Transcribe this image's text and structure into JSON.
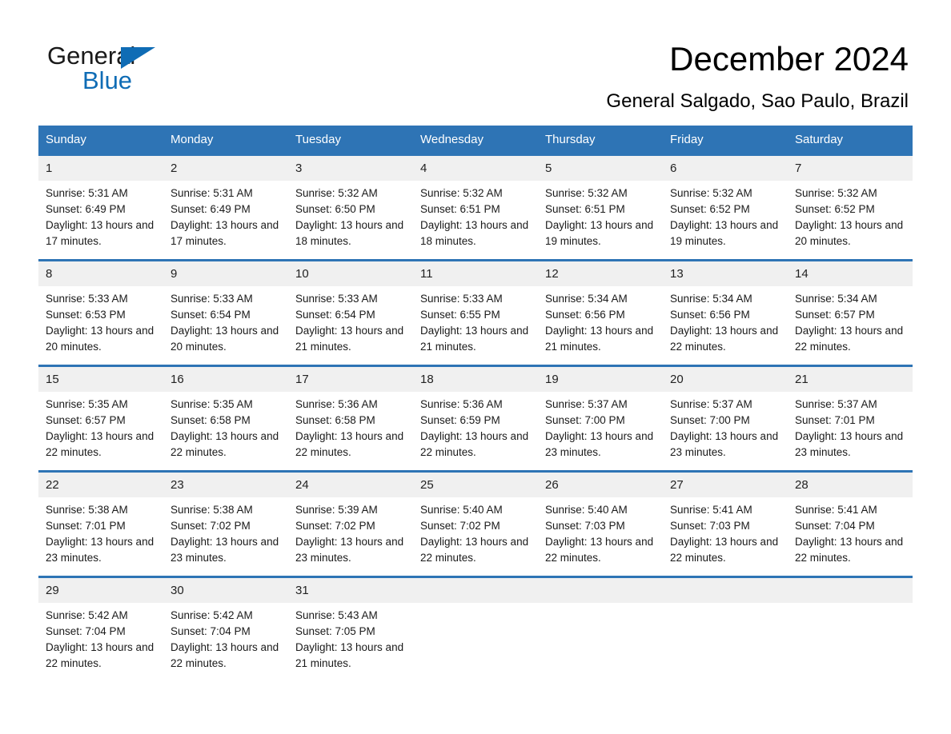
{
  "brand": {
    "name_part1": "General",
    "name_part2": "Blue",
    "accent_color": "#0f6cb5",
    "triangle_icon": "triangle-icon"
  },
  "header": {
    "title": "December 2024",
    "subtitle": "General Salgado, Sao Paulo, Brazil"
  },
  "calendar": {
    "header_color": "#2e74b5",
    "day_band_color": "#f0f0f0",
    "weekday_headers": [
      "Sunday",
      "Monday",
      "Tuesday",
      "Wednesday",
      "Thursday",
      "Friday",
      "Saturday"
    ],
    "weeks": [
      [
        {
          "day": "1",
          "sunrise": "Sunrise: 5:31 AM",
          "sunset": "Sunset: 6:49 PM",
          "daylight": "Daylight: 13 hours and 17 minutes."
        },
        {
          "day": "2",
          "sunrise": "Sunrise: 5:31 AM",
          "sunset": "Sunset: 6:49 PM",
          "daylight": "Daylight: 13 hours and 17 minutes."
        },
        {
          "day": "3",
          "sunrise": "Sunrise: 5:32 AM",
          "sunset": "Sunset: 6:50 PM",
          "daylight": "Daylight: 13 hours and 18 minutes."
        },
        {
          "day": "4",
          "sunrise": "Sunrise: 5:32 AM",
          "sunset": "Sunset: 6:51 PM",
          "daylight": "Daylight: 13 hours and 18 minutes."
        },
        {
          "day": "5",
          "sunrise": "Sunrise: 5:32 AM",
          "sunset": "Sunset: 6:51 PM",
          "daylight": "Daylight: 13 hours and 19 minutes."
        },
        {
          "day": "6",
          "sunrise": "Sunrise: 5:32 AM",
          "sunset": "Sunset: 6:52 PM",
          "daylight": "Daylight: 13 hours and 19 minutes."
        },
        {
          "day": "7",
          "sunrise": "Sunrise: 5:32 AM",
          "sunset": "Sunset: 6:52 PM",
          "daylight": "Daylight: 13 hours and 20 minutes."
        }
      ],
      [
        {
          "day": "8",
          "sunrise": "Sunrise: 5:33 AM",
          "sunset": "Sunset: 6:53 PM",
          "daylight": "Daylight: 13 hours and 20 minutes."
        },
        {
          "day": "9",
          "sunrise": "Sunrise: 5:33 AM",
          "sunset": "Sunset: 6:54 PM",
          "daylight": "Daylight: 13 hours and 20 minutes."
        },
        {
          "day": "10",
          "sunrise": "Sunrise: 5:33 AM",
          "sunset": "Sunset: 6:54 PM",
          "daylight": "Daylight: 13 hours and 21 minutes."
        },
        {
          "day": "11",
          "sunrise": "Sunrise: 5:33 AM",
          "sunset": "Sunset: 6:55 PM",
          "daylight": "Daylight: 13 hours and 21 minutes."
        },
        {
          "day": "12",
          "sunrise": "Sunrise: 5:34 AM",
          "sunset": "Sunset: 6:56 PM",
          "daylight": "Daylight: 13 hours and 21 minutes."
        },
        {
          "day": "13",
          "sunrise": "Sunrise: 5:34 AM",
          "sunset": "Sunset: 6:56 PM",
          "daylight": "Daylight: 13 hours and 22 minutes."
        },
        {
          "day": "14",
          "sunrise": "Sunrise: 5:34 AM",
          "sunset": "Sunset: 6:57 PM",
          "daylight": "Daylight: 13 hours and 22 minutes."
        }
      ],
      [
        {
          "day": "15",
          "sunrise": "Sunrise: 5:35 AM",
          "sunset": "Sunset: 6:57 PM",
          "daylight": "Daylight: 13 hours and 22 minutes."
        },
        {
          "day": "16",
          "sunrise": "Sunrise: 5:35 AM",
          "sunset": "Sunset: 6:58 PM",
          "daylight": "Daylight: 13 hours and 22 minutes."
        },
        {
          "day": "17",
          "sunrise": "Sunrise: 5:36 AM",
          "sunset": "Sunset: 6:58 PM",
          "daylight": "Daylight: 13 hours and 22 minutes."
        },
        {
          "day": "18",
          "sunrise": "Sunrise: 5:36 AM",
          "sunset": "Sunset: 6:59 PM",
          "daylight": "Daylight: 13 hours and 22 minutes."
        },
        {
          "day": "19",
          "sunrise": "Sunrise: 5:37 AM",
          "sunset": "Sunset: 7:00 PM",
          "daylight": "Daylight: 13 hours and 23 minutes."
        },
        {
          "day": "20",
          "sunrise": "Sunrise: 5:37 AM",
          "sunset": "Sunset: 7:00 PM",
          "daylight": "Daylight: 13 hours and 23 minutes."
        },
        {
          "day": "21",
          "sunrise": "Sunrise: 5:37 AM",
          "sunset": "Sunset: 7:01 PM",
          "daylight": "Daylight: 13 hours and 23 minutes."
        }
      ],
      [
        {
          "day": "22",
          "sunrise": "Sunrise: 5:38 AM",
          "sunset": "Sunset: 7:01 PM",
          "daylight": "Daylight: 13 hours and 23 minutes."
        },
        {
          "day": "23",
          "sunrise": "Sunrise: 5:38 AM",
          "sunset": "Sunset: 7:02 PM",
          "daylight": "Daylight: 13 hours and 23 minutes."
        },
        {
          "day": "24",
          "sunrise": "Sunrise: 5:39 AM",
          "sunset": "Sunset: 7:02 PM",
          "daylight": "Daylight: 13 hours and 23 minutes."
        },
        {
          "day": "25",
          "sunrise": "Sunrise: 5:40 AM",
          "sunset": "Sunset: 7:02 PM",
          "daylight": "Daylight: 13 hours and 22 minutes."
        },
        {
          "day": "26",
          "sunrise": "Sunrise: 5:40 AM",
          "sunset": "Sunset: 7:03 PM",
          "daylight": "Daylight: 13 hours and 22 minutes."
        },
        {
          "day": "27",
          "sunrise": "Sunrise: 5:41 AM",
          "sunset": "Sunset: 7:03 PM",
          "daylight": "Daylight: 13 hours and 22 minutes."
        },
        {
          "day": "28",
          "sunrise": "Sunrise: 5:41 AM",
          "sunset": "Sunset: 7:04 PM",
          "daylight": "Daylight: 13 hours and 22 minutes."
        }
      ],
      [
        {
          "day": "29",
          "sunrise": "Sunrise: 5:42 AM",
          "sunset": "Sunset: 7:04 PM",
          "daylight": "Daylight: 13 hours and 22 minutes."
        },
        {
          "day": "30",
          "sunrise": "Sunrise: 5:42 AM",
          "sunset": "Sunset: 7:04 PM",
          "daylight": "Daylight: 13 hours and 22 minutes."
        },
        {
          "day": "31",
          "sunrise": "Sunrise: 5:43 AM",
          "sunset": "Sunset: 7:05 PM",
          "daylight": "Daylight: 13 hours and 21 minutes."
        },
        {
          "day": "",
          "sunrise": "",
          "sunset": "",
          "daylight": ""
        },
        {
          "day": "",
          "sunrise": "",
          "sunset": "",
          "daylight": ""
        },
        {
          "day": "",
          "sunrise": "",
          "sunset": "",
          "daylight": ""
        },
        {
          "day": "",
          "sunrise": "",
          "sunset": "",
          "daylight": ""
        }
      ]
    ]
  }
}
